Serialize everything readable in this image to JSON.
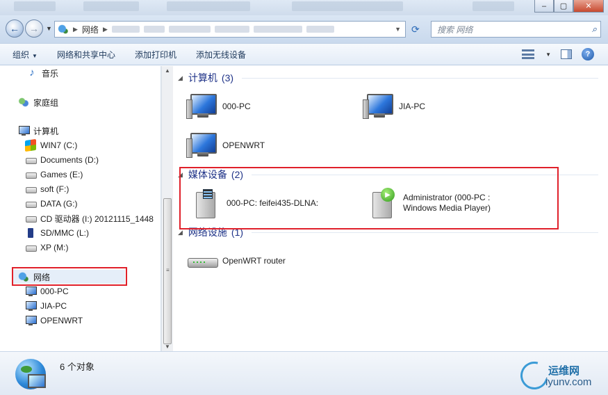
{
  "address": {
    "breadcrumb": "网络",
    "search_placeholder": "搜索 网络"
  },
  "toolbar": {
    "organize": "组织",
    "network_sharing_center": "网络和共享中心",
    "add_printer": "添加打印机",
    "add_wireless": "添加无线设备"
  },
  "nav": {
    "music": "音乐",
    "homegroup": "家庭组",
    "computer": "计算机",
    "drives": [
      {
        "label": "WIN7 (C:)",
        "icon": "windows-drive-icon"
      },
      {
        "label": "Documents (D:)",
        "icon": "drive-icon"
      },
      {
        "label": "Games (E:)",
        "icon": "drive-icon"
      },
      {
        "label": "soft (F:)",
        "icon": "drive-icon"
      },
      {
        "label": "DATA (G:)",
        "icon": "drive-icon"
      },
      {
        "label": "CD 驱动器 (I:) 20121115_1448",
        "icon": "cd-drive-icon"
      },
      {
        "label": "SD/MMC (L:)",
        "icon": "sd-card-icon"
      },
      {
        "label": "XP (M:)",
        "icon": "drive-icon"
      }
    ],
    "network": "网络",
    "network_children": [
      "000-PC",
      "JIA-PC",
      "OPENWRT"
    ]
  },
  "content": {
    "groups": {
      "computers": {
        "title": "计算机",
        "count": "(3)"
      },
      "media": {
        "title": "媒体设备",
        "count": "(2)"
      },
      "infrastructure": {
        "title": "网络设施",
        "count": "(1)"
      }
    },
    "computers": [
      "000-PC",
      "JIA-PC",
      "OPENWRT"
    ],
    "media": [
      "000-PC: feifei435-DLNA:",
      "Administrator (000-PC : Windows Media Player)"
    ],
    "infrastructure": [
      "OpenWRT router"
    ]
  },
  "details": {
    "count_text": "6 个对象"
  },
  "watermark": {
    "cn": "运维网",
    "en": "iyunv.com"
  },
  "colors": {
    "highlight_box": "#e0202a",
    "group_title": "#1e3287"
  }
}
